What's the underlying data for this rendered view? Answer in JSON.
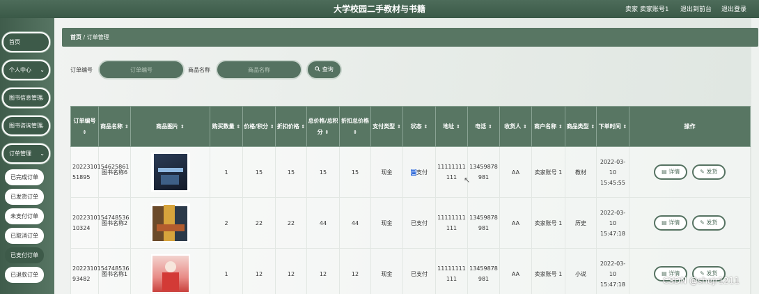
{
  "header": {
    "title": "大学校园二手教材与书籍",
    "user_label": "卖家 卖家账号1",
    "front_link": "退出到前台",
    "logout_link": "退出登录"
  },
  "sidebar": {
    "items": [
      {
        "label": "首页",
        "chevron": ""
      },
      {
        "label": "个人中心",
        "chevron": "⌄"
      },
      {
        "label": "图书信息管理",
        "chevron": "⌄"
      },
      {
        "label": "图书咨询管理",
        "chevron": "⌄"
      },
      {
        "label": "订单管理",
        "chevron": "⌄"
      }
    ],
    "subitems": [
      {
        "label": "已完成订单"
      },
      {
        "label": "已发货订单"
      },
      {
        "label": "未支付订单"
      },
      {
        "label": "已取消订单"
      },
      {
        "label": "已支付订单"
      },
      {
        "label": "已退款订单"
      }
    ]
  },
  "breadcrumb": {
    "home": "首页",
    "sep": "/",
    "current": "订单管理"
  },
  "search": {
    "order_label": "订单编号",
    "order_placeholder": "订单编号",
    "name_label": "商品名称",
    "name_placeholder": "商品名称",
    "button_label": "查询",
    "search_icon": "search-icon"
  },
  "table": {
    "headers": [
      {
        "label": "订单编号",
        "sort": "⇕"
      },
      {
        "label": "商品名称",
        "sort": "⇕"
      },
      {
        "label": "商品图片",
        "sort": "⇕"
      },
      {
        "label": "购买数量",
        "sort": "⇕"
      },
      {
        "label": "价格/积分",
        "sort": "⇕"
      },
      {
        "label": "折扣价格",
        "sort": "⇕"
      },
      {
        "label": "总价格/总积分",
        "sort": "⇕"
      },
      {
        "label": "折扣总价格",
        "sort": "⇕"
      },
      {
        "label": "支付类型",
        "sort": "⇕"
      },
      {
        "label": "状态",
        "sort": "⇕"
      },
      {
        "label": "地址",
        "sort": "⇕"
      },
      {
        "label": "电话",
        "sort": "⇕"
      },
      {
        "label": "收货人",
        "sort": "⇕"
      },
      {
        "label": "商户名称",
        "sort": "⇕"
      },
      {
        "label": "商品类型",
        "sort": "⇕"
      },
      {
        "label": "下单时间",
        "sort": "⇕"
      },
      {
        "label": "操作",
        "sort": ""
      }
    ],
    "rows": [
      {
        "order_no": "2022310154625861 51895",
        "name": "图书名称6",
        "qty": "1",
        "price": "15",
        "discount_price": "15",
        "total": "15",
        "discount_total": "15",
        "pay_type": "现金",
        "status_hl": "已",
        "status_rest": "支付",
        "address": "11111111 111",
        "phone": "13459878 981",
        "receiver": "AA",
        "merchant": "卖家账号 1",
        "category": "教材",
        "time": "2022-03-10 15:45:55",
        "detail_label": "详情",
        "ship_label": "发货"
      },
      {
        "order_no": "2022310154748536 10324",
        "name": "图书名称2",
        "qty": "2",
        "price": "22",
        "discount_price": "22",
        "total": "44",
        "discount_total": "44",
        "pay_type": "现金",
        "status_hl": "",
        "status_rest": "已支付",
        "address": "11111111 111",
        "phone": "13459878 981",
        "receiver": "AA",
        "merchant": "卖家账号 1",
        "category": "历史",
        "time": "2022-03-10 15:47:18",
        "detail_label": "详情",
        "ship_label": "发货"
      },
      {
        "order_no": "2022310154748536 93482",
        "name": "图书名称1",
        "qty": "1",
        "price": "12",
        "discount_price": "12",
        "total": "12",
        "discount_total": "12",
        "pay_type": "现金",
        "status_hl": "",
        "status_rest": "已支付",
        "address": "11111111 111",
        "phone": "13459878 981",
        "receiver": "AA",
        "merchant": "卖家账号 1",
        "category": "小说",
        "time": "2022-03-10 15:47:18",
        "detail_label": "详情",
        "ship_label": "发货"
      }
    ]
  },
  "watermark": "CSDN @shejr1211",
  "colors": {
    "accent": "#587663",
    "dark": "#3d5a49",
    "highlight": "#2f6ad9"
  }
}
